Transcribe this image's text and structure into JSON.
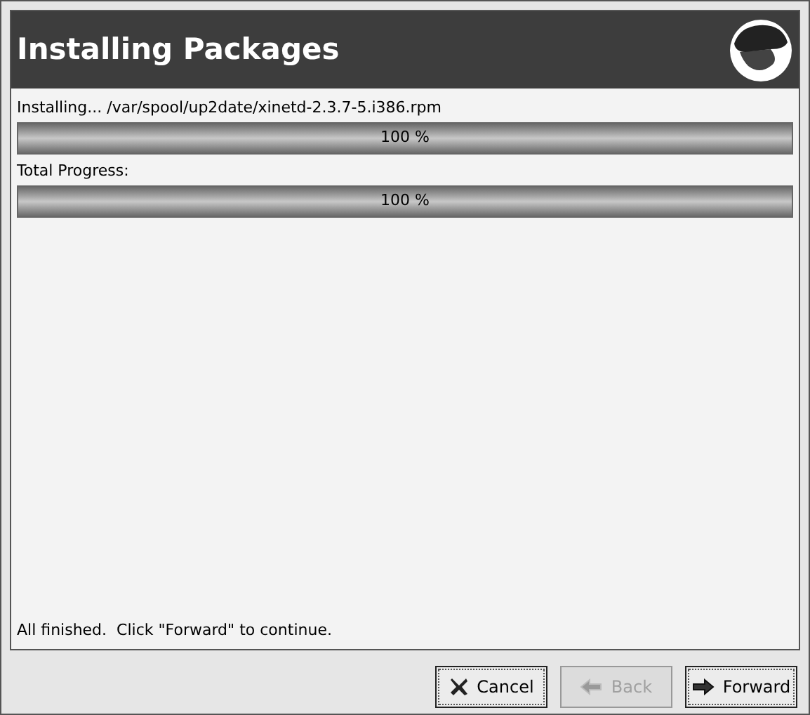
{
  "header": {
    "title": "Installing Packages"
  },
  "progress": [
    {
      "label": "Installing... /var/spool/up2date/xinetd-2.3.7-5.i386.rpm",
      "level": 1,
      "reading": "100 %"
    },
    {
      "label": "Total Progress:",
      "level": 1,
      "reading": "100 %"
    }
  ],
  "status": "All finished.  Click \"Forward\" to continue.",
  "buttons": [
    {
      "label": "Cancel",
      "kind": "cancel",
      "disabled": false
    },
    {
      "label": "Back",
      "kind": "back",
      "disabled": true
    },
    {
      "label": "Forward",
      "kind": "forward",
      "disabled": false
    }
  ]
}
